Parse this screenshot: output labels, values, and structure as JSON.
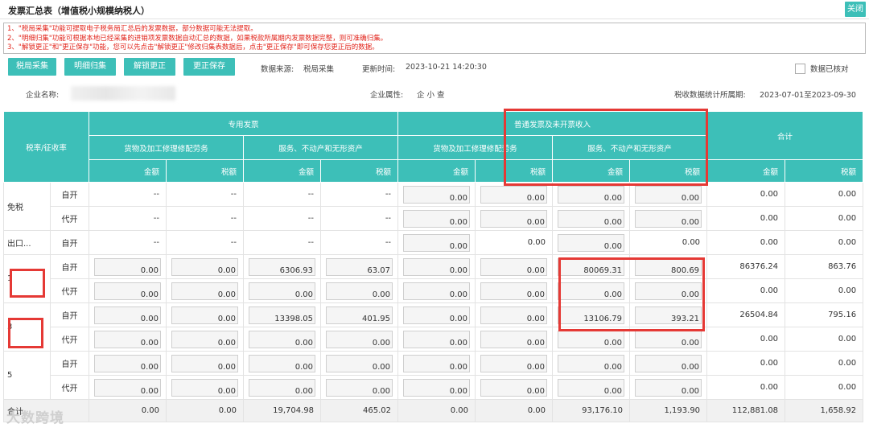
{
  "window": {
    "title": "发票汇总表（增值税小规模纳税人）",
    "close_label": "关闭"
  },
  "notices": [
    "1、\"税局采集\"功能可提取电子税务局汇总后的发票数据，部分数据可能无法提取。",
    "2、\"明细归集\"功能可根据本地已经采集的进销项发票数据自动汇总的数据，如果税款所属期内发票数据完整，则可准确归集。",
    "3、\"解锁更正\"和\"更正保存\"功能，您可以先点击\"解锁更正\"修改归集表数据后，点击\"更正保存\"即可保存您更正后的数据。"
  ],
  "toolbar": {
    "buttons": [
      "税局采集",
      "明细归集",
      "解锁更正",
      "更正保存"
    ],
    "source_label": "数据来源:",
    "source_value": "税局采集",
    "update_label": "更新时间:",
    "update_value": "2023-10-21 14:20:30",
    "verified_label": "数据已核对"
  },
  "info": {
    "company_label": "企业名称:",
    "attr_label": "企业属性:",
    "attr_value": "企 小 查",
    "period_label": "税收数据统计所属期:",
    "period_value": "2023-07-01至2023-09-30"
  },
  "table": {
    "rate_header": "税率/征收率",
    "special_header": "专用发票",
    "general_header": "普通发票及未开票收入",
    "total_header": "合计",
    "goods_header": "货物及加工修理修配劳务",
    "service_header": "服务、不动产和无形资产",
    "amount_header": "金额",
    "tax_header": "税额",
    "rows": {
      "r0": {
        "label": "免税",
        "sub": "自开",
        "c": [
          "--",
          "--",
          "--",
          "--",
          "0.00",
          "0.00",
          "0.00",
          "0.00",
          "0.00",
          "0.00"
        ]
      },
      "r1": {
        "sub": "代开",
        "c": [
          "--",
          "--",
          "--",
          "--",
          "0.00",
          "0.00",
          "0.00",
          "0.00",
          "0.00",
          "0.00"
        ]
      },
      "r2": {
        "label": "出口...",
        "sub": "自开",
        "c": [
          "--",
          "--",
          "--",
          "--",
          "0.00",
          "0.00",
          "0.00",
          "0.00",
          "0.00",
          "0.00"
        ]
      },
      "r3": {
        "label": "1",
        "sub": "自开",
        "c": [
          "0.00",
          "0.00",
          "6306.93",
          "63.07",
          "0.00",
          "0.00",
          "80069.31",
          "800.69",
          "86376.24",
          "863.76"
        ]
      },
      "r4": {
        "sub": "代开",
        "c": [
          "0.00",
          "0.00",
          "0.00",
          "0.00",
          "0.00",
          "0.00",
          "0.00",
          "0.00",
          "0.00",
          "0.00"
        ]
      },
      "r5": {
        "label": "3",
        "sub": "自开",
        "c": [
          "0.00",
          "0.00",
          "13398.05",
          "401.95",
          "0.00",
          "0.00",
          "13106.79",
          "393.21",
          "26504.84",
          "795.16"
        ]
      },
      "r6": {
        "sub": "代开",
        "c": [
          "0.00",
          "0.00",
          "0.00",
          "0.00",
          "0.00",
          "0.00",
          "0.00",
          "0.00",
          "0.00",
          "0.00"
        ]
      },
      "r7": {
        "label": "5",
        "sub": "自开",
        "c": [
          "0.00",
          "0.00",
          "0.00",
          "0.00",
          "0.00",
          "0.00",
          "0.00",
          "0.00",
          "0.00",
          "0.00"
        ]
      },
      "r8": {
        "sub": "代开",
        "c": [
          "0.00",
          "0.00",
          "0.00",
          "0.00",
          "0.00",
          "0.00",
          "0.00",
          "0.00",
          "0.00",
          "0.00"
        ]
      }
    },
    "total": {
      "label": "合计",
      "c": [
        "0.00",
        "0.00",
        "19,704.98",
        "465.02",
        "0.00",
        "0.00",
        "93,176.10",
        "1,193.90",
        "112,881.08",
        "1,658.92"
      ]
    }
  },
  "watermark": "大数跨境"
}
